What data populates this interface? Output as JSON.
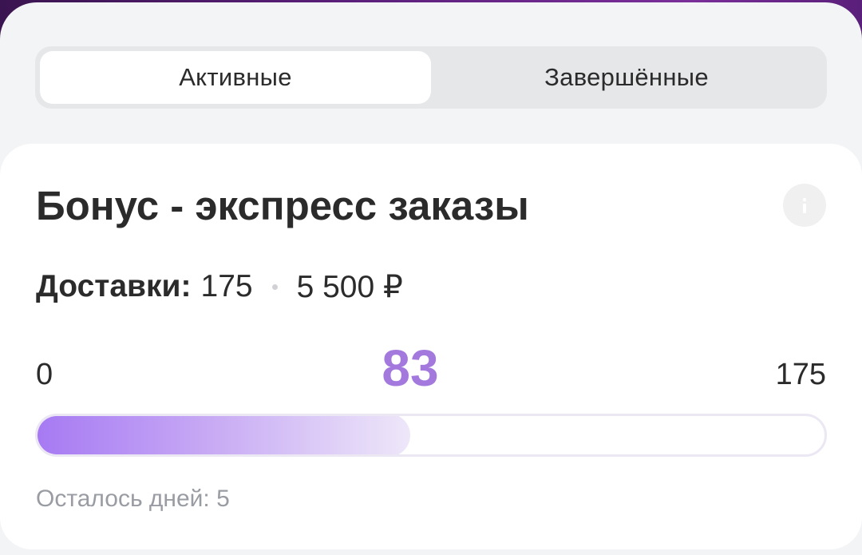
{
  "tabs": [
    {
      "label": "Активные",
      "active": true
    },
    {
      "label": "Завершённые",
      "active": false
    }
  ],
  "bonus_card": {
    "title": "Бонус - экспресс заказы",
    "info_icon": "info-icon",
    "deliveries_label": "Доставки:",
    "deliveries_target": "175",
    "reward": "5 500 ₽",
    "progress": {
      "min": "0",
      "current": "83",
      "max": "175",
      "fraction": 0.474
    },
    "days_left": "Осталось дней: 5"
  },
  "colors": {
    "accent": "#a479de",
    "progress_start": "#a679f3",
    "progress_end": "#eee7f9",
    "background": "#f3f4f6",
    "card": "#ffffff",
    "text_primary": "#2b2b2b",
    "text_secondary": "#9a9ca3"
  }
}
